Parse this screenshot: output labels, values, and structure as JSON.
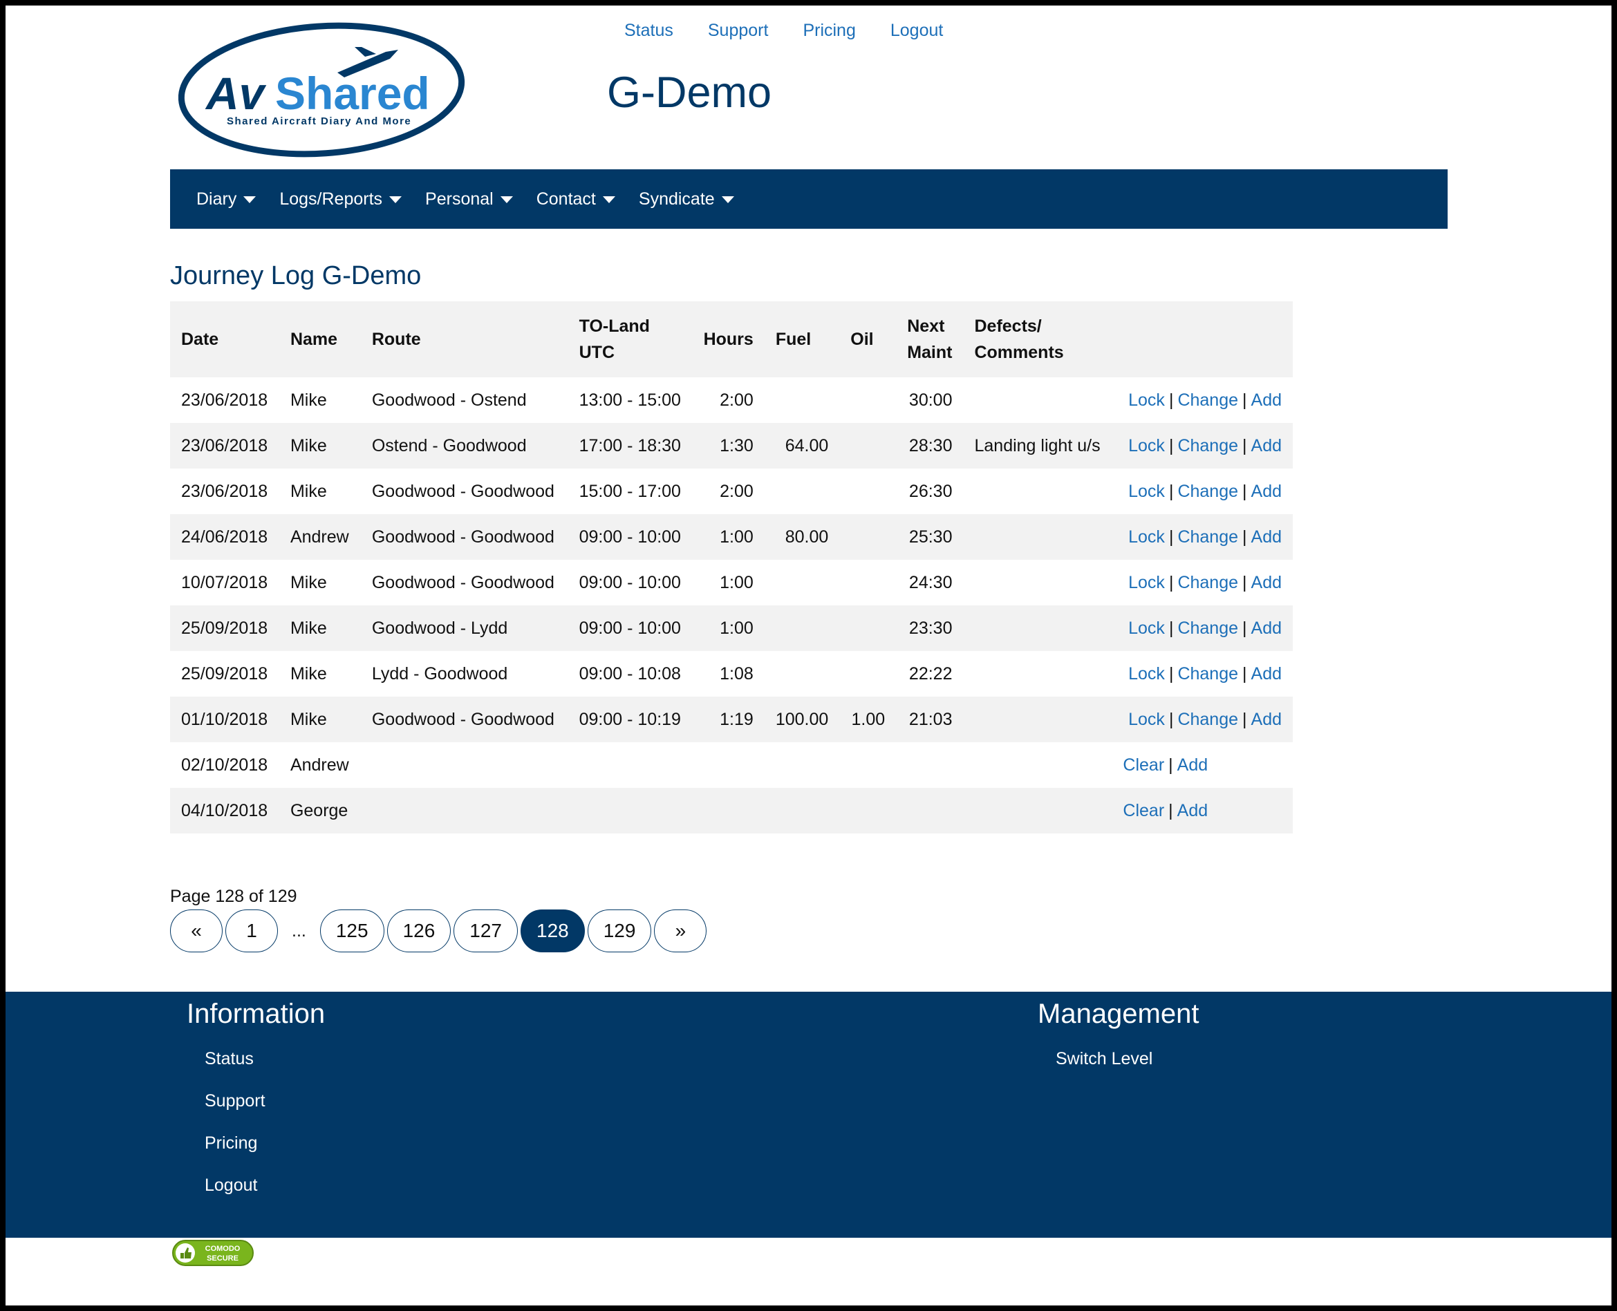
{
  "logo": {
    "text": "AvShared",
    "tagline": "Shared Aircraft Diary And More"
  },
  "top_links": [
    "Status",
    "Support",
    "Pricing",
    "Logout"
  ],
  "site_title": "G-Demo",
  "nav": [
    "Diary",
    "Logs/Reports",
    "Personal",
    "Contact",
    "Syndicate"
  ],
  "page_heading": "Journey Log G-Demo",
  "table": {
    "headers": {
      "date": "Date",
      "name": "Name",
      "route": "Route",
      "toland_1": "TO-Land",
      "toland_2": "UTC",
      "hours": "Hours",
      "fuel": "Fuel",
      "oil": "Oil",
      "maint_1": "Next",
      "maint_2": "Maint",
      "defects_1": "Defects/",
      "defects_2": "Comments"
    },
    "rows": [
      {
        "date": "23/06/2018",
        "name": "Mike",
        "route": "Goodwood - Ostend",
        "toland": "13:00 - 15:00",
        "hours": "2:00",
        "fuel": "",
        "oil": "",
        "maint": "30:00",
        "defects": "",
        "a1": "Lock",
        "a2": "Change",
        "a3": "Add"
      },
      {
        "date": "23/06/2018",
        "name": "Mike",
        "route": "Ostend - Goodwood",
        "toland": "17:00 - 18:30",
        "hours": "1:30",
        "fuel": "64.00",
        "oil": "",
        "maint": "28:30",
        "defects": "Landing light u/s",
        "a1": "Lock",
        "a2": "Change",
        "a3": "Add"
      },
      {
        "date": "23/06/2018",
        "name": "Mike",
        "route": "Goodwood - Goodwood",
        "toland": "15:00 - 17:00",
        "hours": "2:00",
        "fuel": "",
        "oil": "",
        "maint": "26:30",
        "defects": "",
        "a1": "Lock",
        "a2": "Change",
        "a3": "Add"
      },
      {
        "date": "24/06/2018",
        "name": "Andrew",
        "route": "Goodwood - Goodwood",
        "toland": "09:00 - 10:00",
        "hours": "1:00",
        "fuel": "80.00",
        "oil": "",
        "maint": "25:30",
        "defects": "",
        "a1": "Lock",
        "a2": "Change",
        "a3": "Add"
      },
      {
        "date": "10/07/2018",
        "name": "Mike",
        "route": "Goodwood - Goodwood",
        "toland": "09:00 - 10:00",
        "hours": "1:00",
        "fuel": "",
        "oil": "",
        "maint": "24:30",
        "defects": "",
        "a1": "Lock",
        "a2": "Change",
        "a3": "Add"
      },
      {
        "date": "25/09/2018",
        "name": "Mike",
        "route": "Goodwood - Lydd",
        "toland": "09:00 - 10:00",
        "hours": "1:00",
        "fuel": "",
        "oil": "",
        "maint": "23:30",
        "defects": "",
        "a1": "Lock",
        "a2": "Change",
        "a3": "Add"
      },
      {
        "date": "25/09/2018",
        "name": "Mike",
        "route": "Lydd - Goodwood",
        "toland": "09:00 - 10:08",
        "hours": "1:08",
        "fuel": "",
        "oil": "",
        "maint": "22:22",
        "defects": "",
        "a1": "Lock",
        "a2": "Change",
        "a3": "Add"
      },
      {
        "date": "01/10/2018",
        "name": "Mike",
        "route": "Goodwood - Goodwood",
        "toland": "09:00 - 10:19",
        "hours": "1:19",
        "fuel": "100.00",
        "oil": "1.00",
        "maint": "21:03",
        "defects": "",
        "a1": "Lock",
        "a2": "Change",
        "a3": "Add"
      },
      {
        "date": "02/10/2018",
        "name": "Andrew",
        "route": "",
        "toland": "",
        "hours": "",
        "fuel": "",
        "oil": "",
        "maint": "",
        "defects": "",
        "a1": "Clear",
        "a2": "Add"
      },
      {
        "date": "04/10/2018",
        "name": "George",
        "route": "",
        "toland": "",
        "hours": "",
        "fuel": "",
        "oil": "",
        "maint": "",
        "defects": "",
        "a1": "Clear",
        "a2": "Add"
      }
    ]
  },
  "pagination": {
    "info": "Page 128 of 129",
    "prev": "«",
    "next": "»",
    "ellipsis": "...",
    "pages": [
      "1",
      "125",
      "126",
      "127",
      "128",
      "129"
    ],
    "active": "128"
  },
  "footer": {
    "info_heading": "Information",
    "info_links": [
      "Status",
      "Support",
      "Pricing",
      "Logout"
    ],
    "mgmt_heading": "Management",
    "mgmt_links": [
      "Switch Level"
    ]
  },
  "badge": {
    "line1": "COMODO",
    "line2": "SECURE"
  },
  "colors": {
    "brand": "#023866",
    "link": "#1d6fb8",
    "stripe": "#f2f2f2",
    "badge": "#7ab51d"
  }
}
